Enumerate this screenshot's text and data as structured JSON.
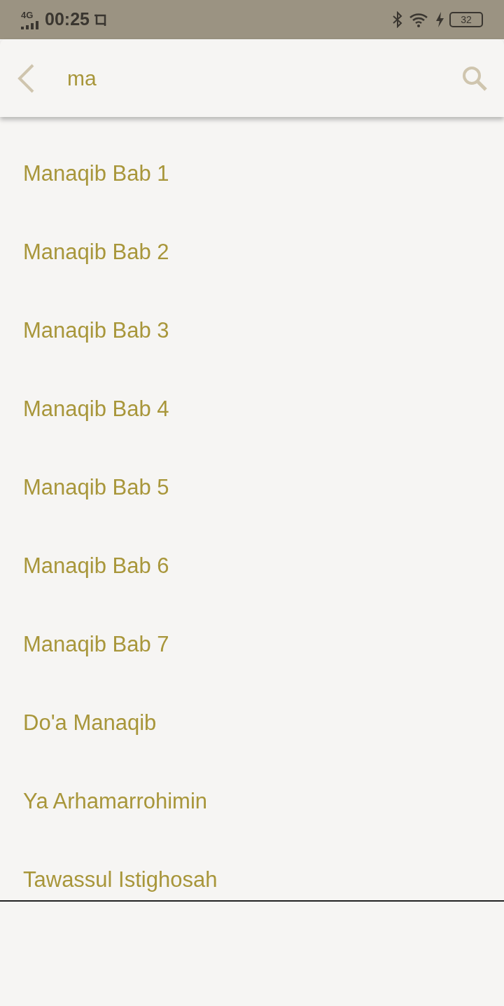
{
  "status_bar": {
    "network": "4G",
    "time": "00:25",
    "battery": "32"
  },
  "search": {
    "value": "ma"
  },
  "results": [
    {
      "title": "Manaqib Bab 1"
    },
    {
      "title": "Manaqib Bab 2"
    },
    {
      "title": "Manaqib Bab 3"
    },
    {
      "title": "Manaqib Bab 4"
    },
    {
      "title": "Manaqib Bab 5"
    },
    {
      "title": "Manaqib Bab 6"
    },
    {
      "title": "Manaqib Bab 7"
    },
    {
      "title": "Do'a Manaqib"
    },
    {
      "title": "Ya Arhamarrohimin"
    },
    {
      "title": "Tawassul Istighosah"
    }
  ]
}
